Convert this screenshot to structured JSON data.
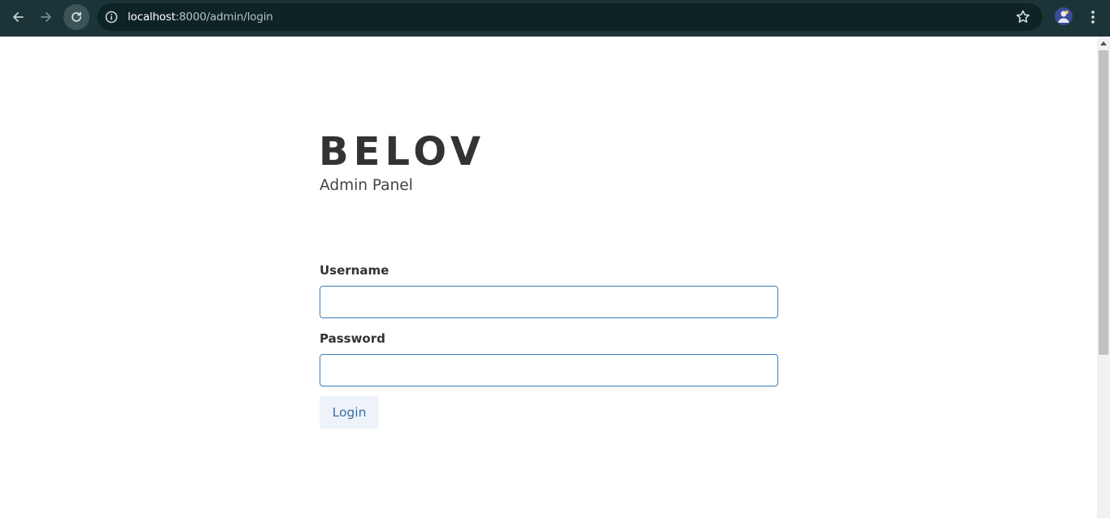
{
  "browser": {
    "url_host": "localhost",
    "url_rest": ":8000/admin/login",
    "icons": {
      "back": "back-arrow-icon",
      "forward": "forward-arrow-icon",
      "reload": "reload-icon",
      "site_info": "info-icon",
      "bookmark": "star-icon",
      "profile": "avatar",
      "menu": "more-vert-icon"
    }
  },
  "header": {
    "brand": "BELOV",
    "subtitle": "Admin Panel"
  },
  "form": {
    "username_label": "Username",
    "username_value": "",
    "password_label": "Password",
    "password_value": "",
    "login_label": "Login"
  },
  "colors": {
    "chrome_bg": "#1b3437",
    "omnibox_bg": "#0e2326",
    "input_border": "#3c7dbd",
    "button_bg": "#eef3fa",
    "button_text": "#3a6fa3",
    "brand_text": "#333333"
  }
}
